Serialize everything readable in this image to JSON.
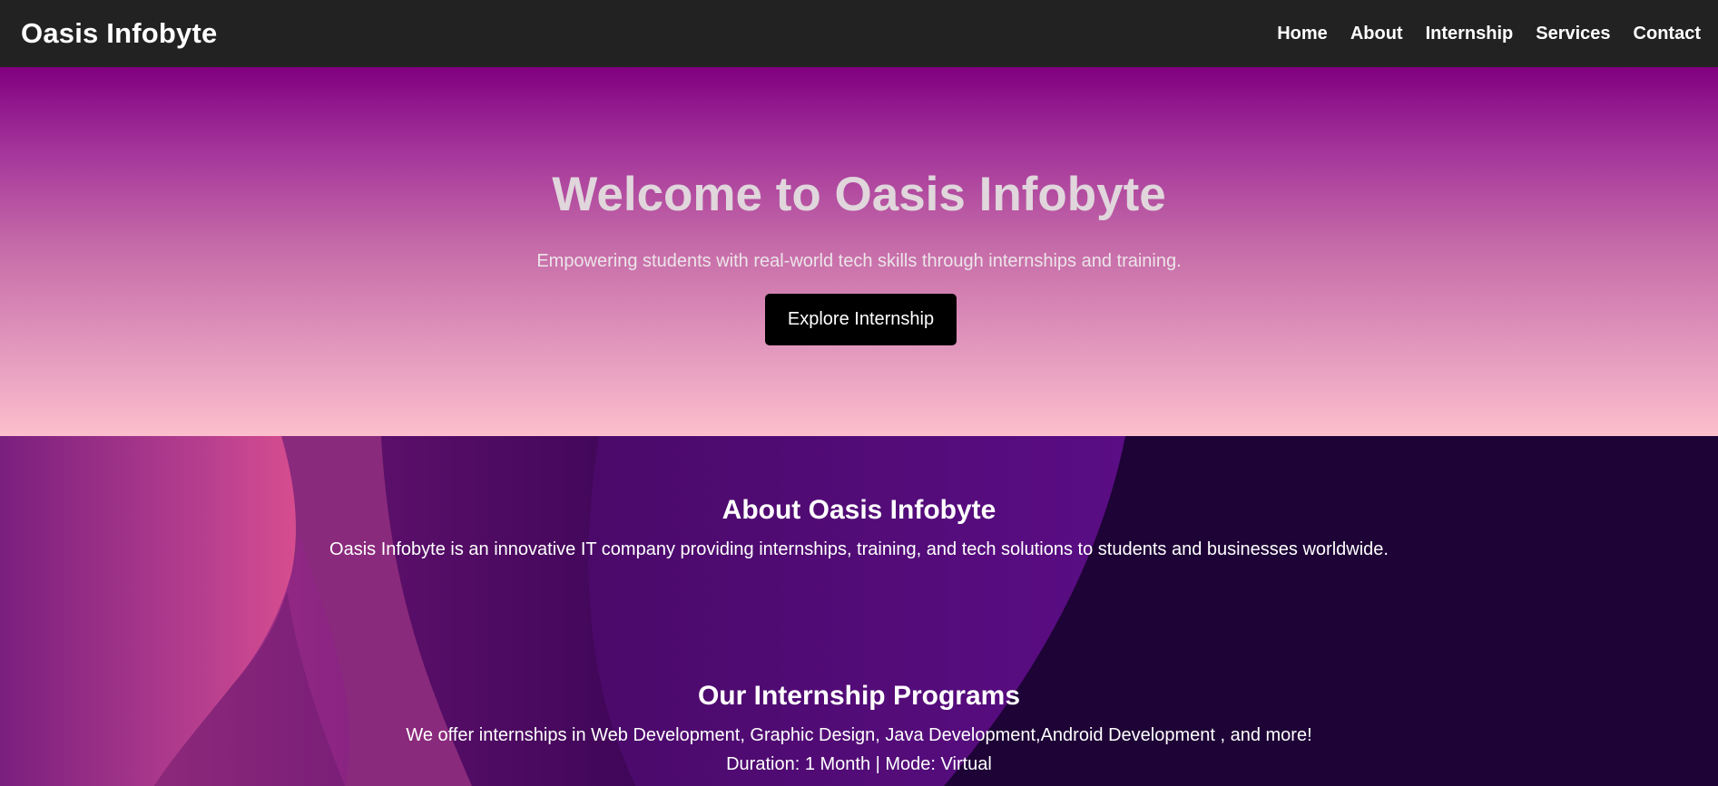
{
  "navbar": {
    "brand": "Oasis Infobyte",
    "links": [
      "Home",
      "About",
      "Internship",
      "Services",
      "Contact"
    ]
  },
  "hero": {
    "title": "Welcome to Oasis Infobyte",
    "subtitle": "Empowering students with real-world tech skills through internships and training.",
    "button_label": "Explore Internship"
  },
  "about": {
    "title": "About Oasis Infobyte",
    "text": "Oasis Infobyte is an innovative IT company providing internships, training, and tech solutions to students and businesses worldwide."
  },
  "internship": {
    "title": "Our Internship Programs",
    "text": "We offer internships in Web Development, Graphic Design, Java Development,Android Development , and more!",
    "details": "Duration: 1 Month | Mode: Virtual"
  },
  "colors": {
    "navbar_bg": "#222222",
    "hero_top": "#800080",
    "hero_bottom": "#fcbfcc",
    "button_bg": "#000000",
    "lower_bg": "#1e0336"
  }
}
